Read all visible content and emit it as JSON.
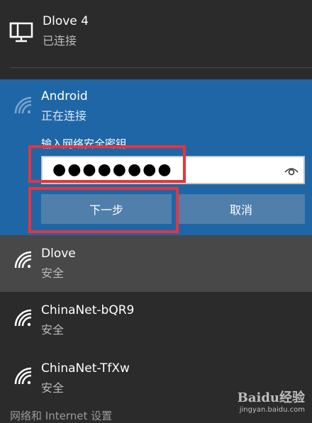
{
  "networks": {
    "wired": {
      "name": "Dlove 4",
      "status": "已连接",
      "icon": "ethernet-monitor-icon"
    },
    "android": {
      "name": "Android",
      "status": "正在连接",
      "password_label": "输入网络安全密钥",
      "password_value": "●●●●●●●●",
      "next_label": "下一步",
      "cancel_label": "取消",
      "icon": "wifi-icon"
    },
    "list": [
      {
        "name": "Dlove",
        "status": "安全",
        "icon": "wifi-icon"
      },
      {
        "name": "ChinaNet-bQR9",
        "status": "安全",
        "icon": "wifi-icon"
      },
      {
        "name": "ChinaNet-TfXw",
        "status": "安全",
        "icon": "wifi-icon"
      }
    ],
    "settings_partial": "网络和 Internet 设置"
  },
  "watermark": {
    "logo": "Baidu经验",
    "url": "jingyan.baidu.com"
  },
  "colors": {
    "selected_bg": "#1f66a6",
    "button_bg": "#4f7faa",
    "annotation": "#e8343c",
    "hover_bg": "#484848"
  }
}
